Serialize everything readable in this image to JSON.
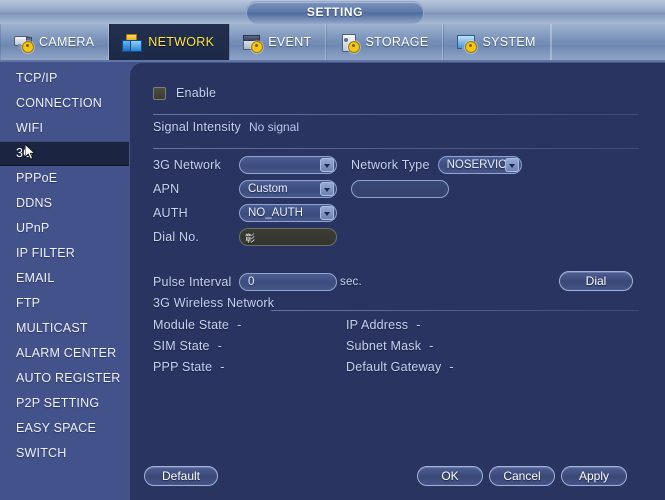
{
  "window": {
    "title": "SETTING"
  },
  "tabs": [
    {
      "label": "CAMERA",
      "icon": "camera-icon",
      "active": false
    },
    {
      "label": "NETWORK",
      "icon": "network-icon",
      "active": true
    },
    {
      "label": "EVENT",
      "icon": "event-icon",
      "active": false
    },
    {
      "label": "STORAGE",
      "icon": "storage-icon",
      "active": false
    },
    {
      "label": "SYSTEM",
      "icon": "system-icon",
      "active": false
    }
  ],
  "sidebar": {
    "items": [
      {
        "label": "TCP/IP",
        "selected": false
      },
      {
        "label": "CONNECTION",
        "selected": false
      },
      {
        "label": "WIFI",
        "selected": false
      },
      {
        "label": "3G",
        "selected": true
      },
      {
        "label": "PPPoE",
        "selected": false
      },
      {
        "label": "DDNS",
        "selected": false
      },
      {
        "label": "UPnP",
        "selected": false
      },
      {
        "label": "IP FILTER",
        "selected": false
      },
      {
        "label": "EMAIL",
        "selected": false
      },
      {
        "label": "FTP",
        "selected": false
      },
      {
        "label": "MULTICAST",
        "selected": false
      },
      {
        "label": "ALARM CENTER",
        "selected": false
      },
      {
        "label": "AUTO REGISTER",
        "selected": false
      },
      {
        "label": "P2P SETTING",
        "selected": false
      },
      {
        "label": "EASY SPACE",
        "selected": false
      },
      {
        "label": "SWITCH",
        "selected": false
      }
    ]
  },
  "form": {
    "enable": {
      "label": "Enable",
      "checked": false
    },
    "signal_intensity": {
      "label": "Signal Intensity",
      "value": "No signal"
    },
    "network_3g": {
      "label": "3G Network",
      "value": ""
    },
    "network_type": {
      "label": "Network Type",
      "value": "NOSERVICE"
    },
    "apn": {
      "label": "APN",
      "value": "Custom",
      "text": ""
    },
    "auth": {
      "label": "AUTH",
      "value": "NO_AUTH"
    },
    "dial_no": {
      "label": "Dial No.",
      "value": "彰"
    },
    "pulse_interval": {
      "label": "Pulse Interval",
      "value": "0",
      "unit": "sec."
    },
    "dial_button": "Dial"
  },
  "status": {
    "section_title": "3G Wireless Network",
    "left": [
      {
        "label": "Module State",
        "value": "-"
      },
      {
        "label": "SIM State",
        "value": "-"
      },
      {
        "label": "PPP State",
        "value": "-"
      }
    ],
    "right": [
      {
        "label": "IP Address",
        "value": "-"
      },
      {
        "label": "Subnet Mask",
        "value": "-"
      },
      {
        "label": "Default Gateway",
        "value": "-"
      }
    ]
  },
  "footer": {
    "default_label": "Default",
    "ok_label": "OK",
    "cancel_label": "Cancel",
    "apply_label": "Apply"
  },
  "colors": {
    "sidebar_bg": "#44528c",
    "panel_bg": "#2a3460",
    "selected_bg": "#1b2440",
    "active_tab_text": "#ffe54a",
    "label_text": "#c6d2ef"
  }
}
